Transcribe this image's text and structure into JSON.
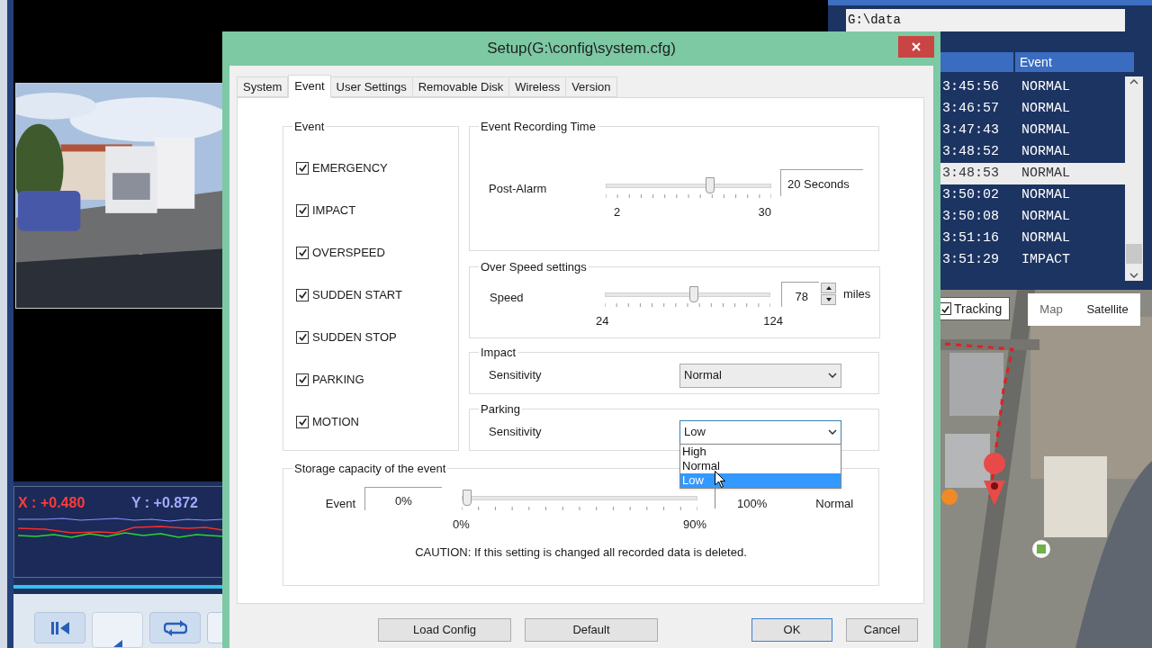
{
  "background_app": {
    "accelerometer": {
      "x_reading": "X : +0.480",
      "y_reading": "Y : +0.872"
    },
    "playback": {
      "level": 1
    },
    "path_field": {
      "value": "G:\\data"
    },
    "event_list": {
      "columns": [
        "Event"
      ],
      "rows": [
        {
          "time": "3:45:56",
          "event": "NORMAL",
          "selected": false
        },
        {
          "time": "3:46:57",
          "event": "NORMAL",
          "selected": false
        },
        {
          "time": "3:47:43",
          "event": "NORMAL",
          "selected": false
        },
        {
          "time": "3:48:52",
          "event": "NORMAL",
          "selected": false
        },
        {
          "time": "3:48:53",
          "event": "NORMAL",
          "selected": true
        },
        {
          "time": "3:50:02",
          "event": "NORMAL",
          "selected": false
        },
        {
          "time": "3:50:08",
          "event": "NORMAL",
          "selected": false
        },
        {
          "time": "3:51:16",
          "event": "NORMAL",
          "selected": false
        },
        {
          "time": "3:51:29",
          "event": "IMPACT",
          "selected": false
        }
      ]
    },
    "map": {
      "tracking": {
        "label": "Tracking",
        "checked": true
      },
      "map_types": [
        {
          "label": "Map",
          "selected": false
        },
        {
          "label": "Satellite",
          "selected": true
        }
      ]
    }
  },
  "dialog": {
    "title": "Setup(G:\\config\\system.cfg)",
    "tabs": [
      {
        "label": "System",
        "selected": false
      },
      {
        "label": "Event",
        "selected": true
      },
      {
        "label": "User Settings",
        "selected": false
      },
      {
        "label": "Removable Disk",
        "selected": false
      },
      {
        "label": "Wireless",
        "selected": false
      },
      {
        "label": "Version",
        "selected": false
      }
    ],
    "event_types": {
      "title": "Event",
      "items": [
        {
          "label": "EMERGENCY",
          "checked": true
        },
        {
          "label": "IMPACT",
          "checked": true
        },
        {
          "label": "OVERSPEED",
          "checked": true
        },
        {
          "label": "SUDDEN START",
          "checked": true
        },
        {
          "label": "SUDDEN STOP",
          "checked": true
        },
        {
          "label": "PARKING",
          "checked": true
        },
        {
          "label": "MOTION",
          "checked": true
        }
      ]
    },
    "recording_time": {
      "title": "Event Recording Time",
      "label": "Post-Alarm",
      "level": 0.64,
      "min": "2",
      "max": "30",
      "value": "20 Seconds"
    },
    "over_speed": {
      "title": "Over Speed settings",
      "label": "Speed",
      "level": 0.54,
      "min": "24",
      "max": "124",
      "value": "78",
      "unit": "miles"
    },
    "impact": {
      "title": "Impact",
      "label": "Sensitivity",
      "value": "Normal"
    },
    "parking": {
      "title": "Parking",
      "label": "Sensitivity",
      "value": "Low",
      "open": true,
      "options": [
        {
          "label": "High",
          "selected": false
        },
        {
          "label": "Normal",
          "selected": false
        },
        {
          "label": "Low",
          "selected": true
        }
      ]
    },
    "storage": {
      "title": "Storage capacity of the event",
      "label": "Event",
      "value": "0%",
      "level": 0,
      "min": "0%",
      "max": "90%",
      "total": "100%",
      "status": "Normal",
      "caution": "CAUTION: If this setting is changed all recorded data is deleted."
    },
    "buttons": [
      {
        "label": "Load Config",
        "focused": false
      },
      {
        "label": "Default",
        "focused": false
      },
      {
        "label": "OK",
        "focused": true
      },
      {
        "label": "Cancel",
        "focused": false
      }
    ]
  }
}
